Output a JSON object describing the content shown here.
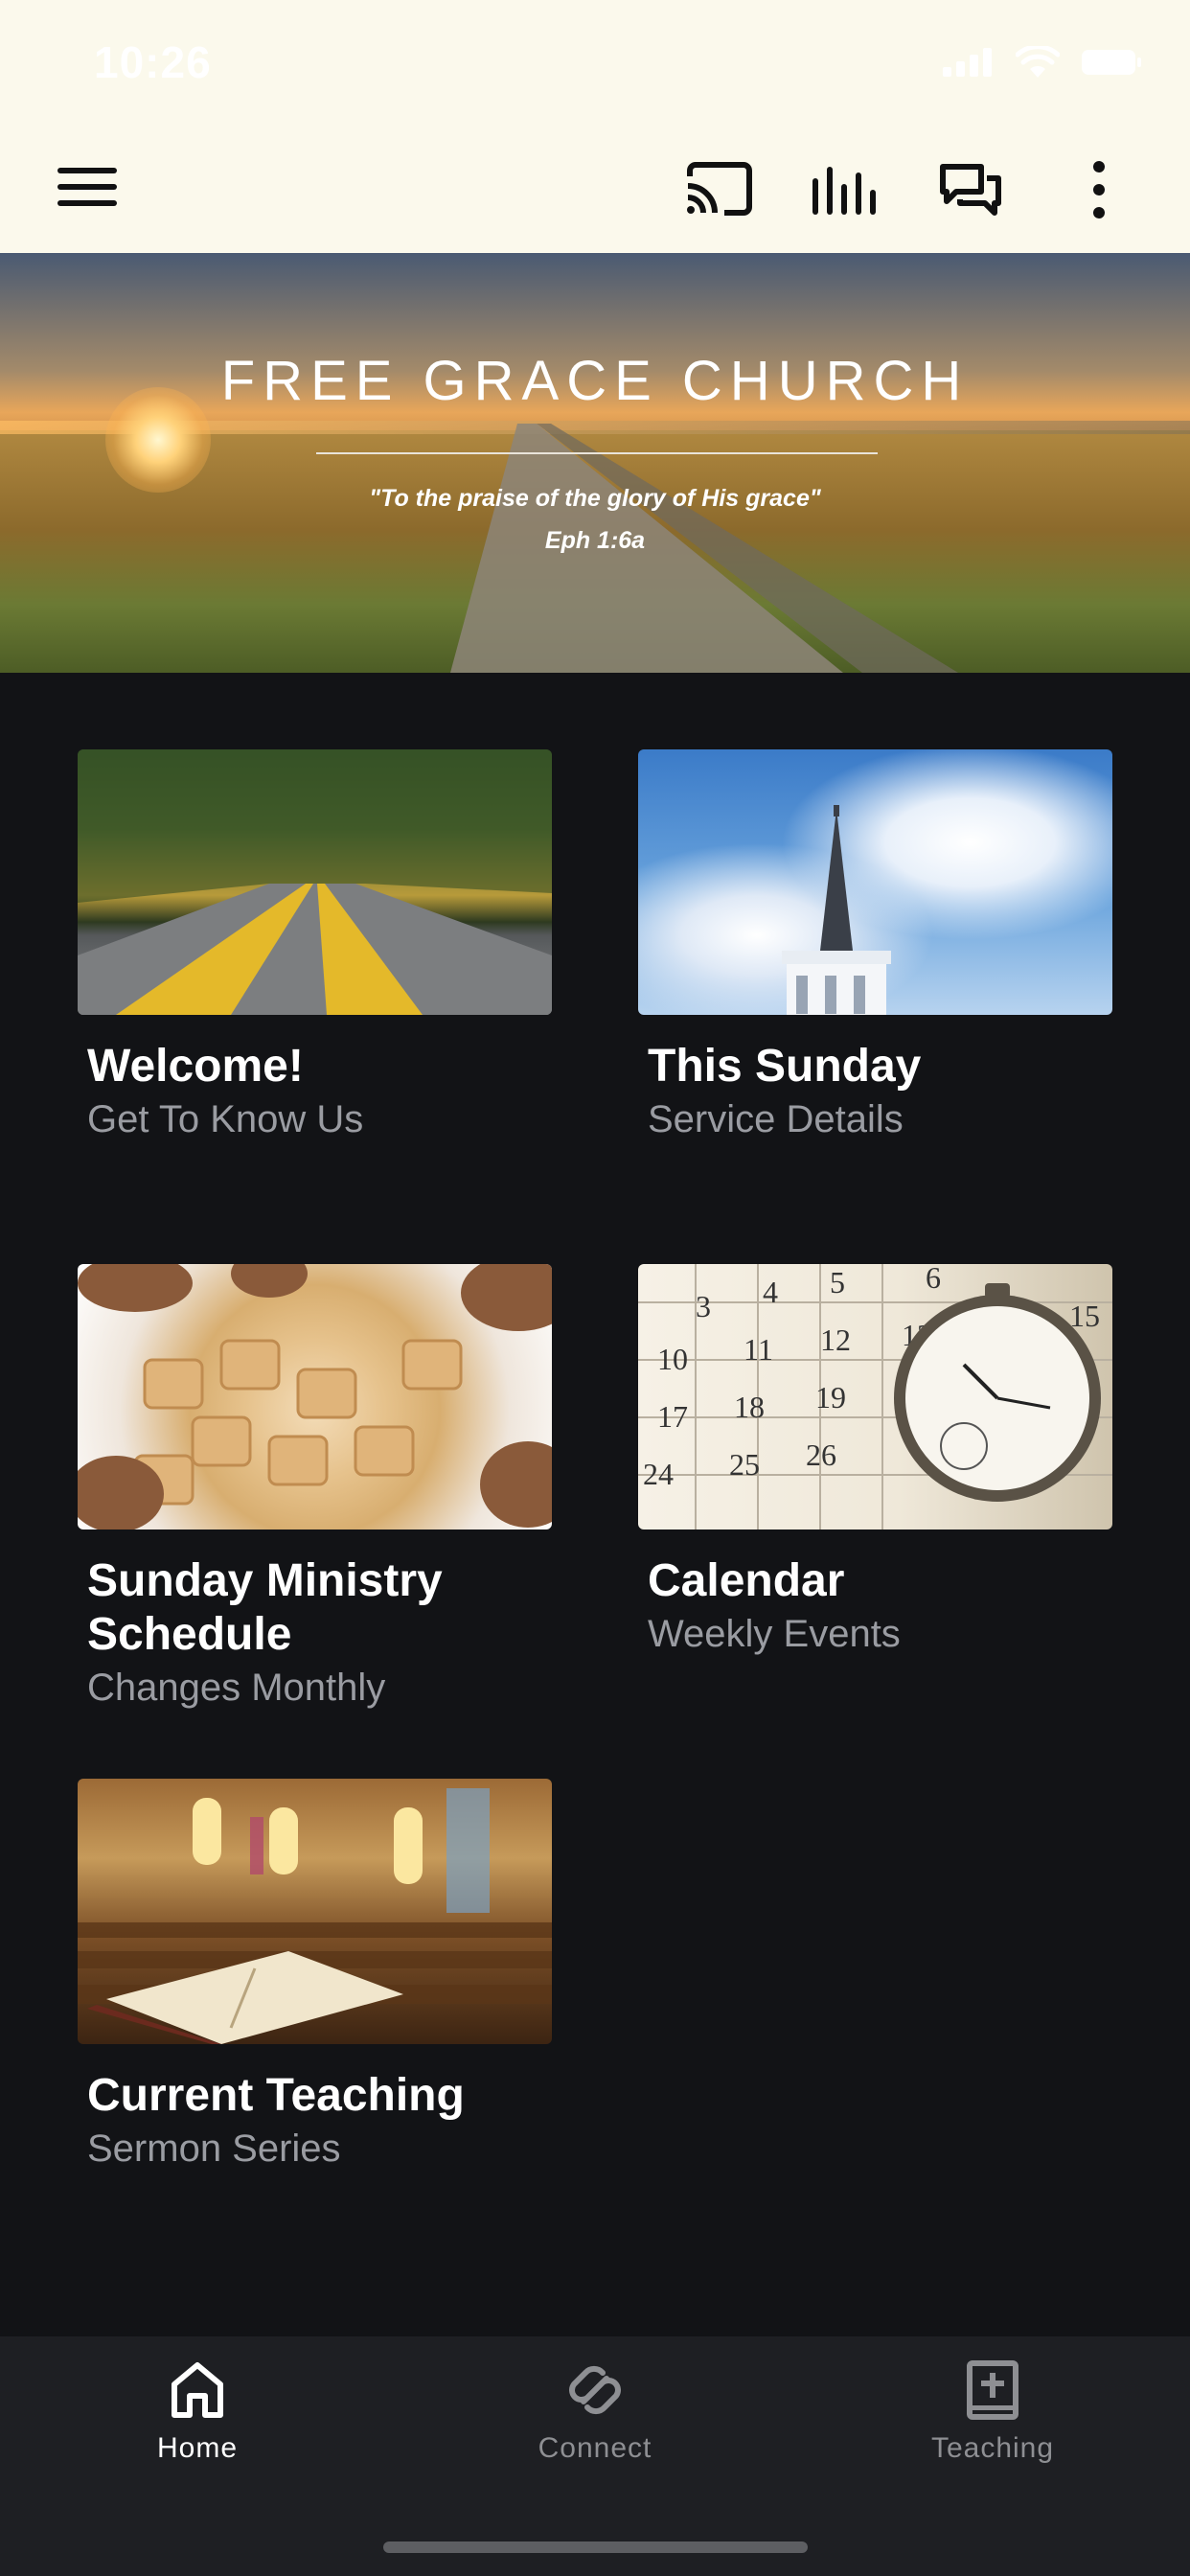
{
  "status_bar": {
    "time": "10:26",
    "icons": [
      "cellular-icon",
      "wifi-icon",
      "battery-icon"
    ]
  },
  "header": {
    "icons": [
      "menu-icon",
      "cast-icon",
      "audio-bars-icon",
      "chat-icon",
      "more-vertical-icon"
    ],
    "background": "#fbf9ec"
  },
  "hero": {
    "title": "FREE GRACE CHURCH",
    "quote": "\"To the praise of the glory of His grace\"",
    "reference": "Eph 1:6a"
  },
  "tiles": [
    {
      "title": "Welcome!",
      "subtitle": "Get To Know Us",
      "image": "road-through-forest"
    },
    {
      "title": "This Sunday",
      "subtitle": "Service Details",
      "image": "church-steeple-sky"
    },
    {
      "title": "Sunday Ministry Schedule",
      "subtitle": "Changes Monthly",
      "image": "hands-with-puzzle-pieces"
    },
    {
      "title": "Calendar",
      "subtitle": "Weekly Events",
      "image": "calendar-pocket-watch"
    },
    {
      "title": "Current Teaching",
      "subtitle": "Sermon Series",
      "image": "open-bible-in-church"
    }
  ],
  "calendar_numbers": [
    "3",
    "4",
    "5",
    "6",
    "10",
    "11",
    "12",
    "13",
    "15",
    "17",
    "18",
    "19",
    "24",
    "25",
    "26"
  ],
  "bottom_nav": {
    "items": [
      {
        "label": "Home",
        "icon": "home-icon",
        "active": true
      },
      {
        "label": "Connect",
        "icon": "connect-icon",
        "active": false
      },
      {
        "label": "Teaching",
        "icon": "bible-icon",
        "active": false
      }
    ],
    "active_color": "#ffffff",
    "inactive_color": "#8e8f93",
    "background": "#1e1f23"
  },
  "colors": {
    "page_background": "#121316",
    "title_text": "#ffffff",
    "subtitle_text": "#9a9ca2"
  }
}
